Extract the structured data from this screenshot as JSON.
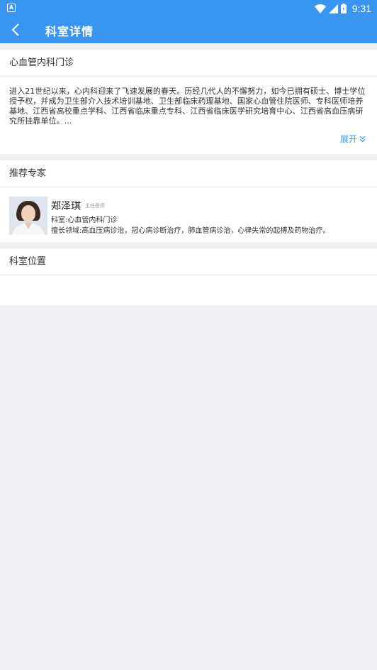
{
  "status_bar": {
    "time": "9:31",
    "notification_icon": "A"
  },
  "navbar": {
    "title": "科室详情"
  },
  "intro": {
    "heading": "心血管内科门诊",
    "text": "进入21世纪以来，心内科迎来了飞速发展的春天。历经几代人的不懈努力，如今已拥有硕士、博士学位授予权，并成为卫生部介入技术培训基地、卫生部临床药理基地、国家心血管住院医师、专科医师培养基地、江西省高校重点学科、江西省临床重点专科、江西省临床医学研究培育中心、江西省高血压病研究所挂靠单位。...",
    "expand_label": "展开"
  },
  "experts": {
    "heading": "推荐专家",
    "items": [
      {
        "name": "郑泽琪",
        "title": "主任医师",
        "dept": "科室:心血管内科门诊",
        "skill": "擅长领域:高血压病诊治，冠心病诊断治疗，肺血管病诊治，心律失常的起搏及药物治疗。"
      }
    ]
  },
  "location": {
    "heading": "科室位置"
  },
  "colors": {
    "brand": "#3a95f1",
    "background": "#efeff4"
  }
}
